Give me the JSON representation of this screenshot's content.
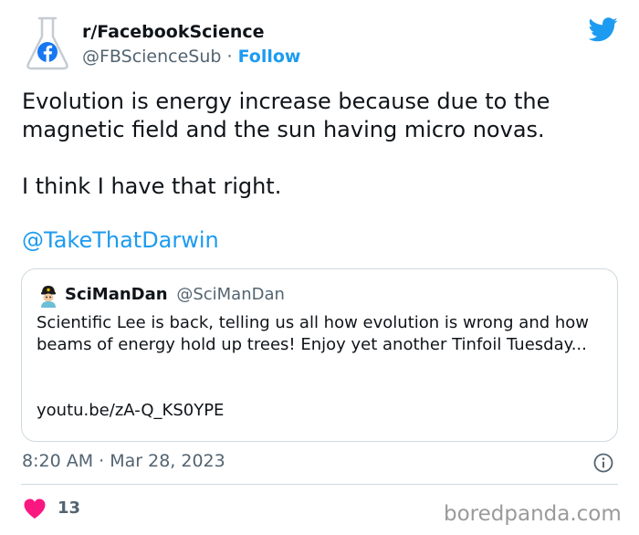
{
  "tweet": {
    "author": {
      "name": "r/FacebookScience",
      "handle": "@FBScienceSub",
      "separator": "·",
      "follow_label": "Follow"
    },
    "text_line1": "Evolution is energy increase because due to the magnetic field and the sun having micro novas.",
    "text_line2": "I think I have that right.",
    "mention": "@TakeThatDarwin",
    "quoted": {
      "name": "SciManDan",
      "handle": "@SciManDan",
      "text": "Scientific Lee is back, telling us all how evolution is wrong and how beams of energy hold up trees! Enjoy yet another Tinfoil Tuesday...",
      "link": "youtu.be/zA-Q_KS0YPE"
    },
    "timestamp": "8:20 AM · Mar 28, 2023",
    "likes": "13"
  },
  "watermark": "boredpanda.com",
  "icons": {
    "avatar": "flask-facebook-logo",
    "brand": "twitter-bird-icon",
    "info": "info-icon",
    "like": "heart-icon"
  },
  "colors": {
    "accent": "#1d9bf0",
    "like": "#f91880",
    "muted": "#536471",
    "border": "#cfd9de"
  }
}
